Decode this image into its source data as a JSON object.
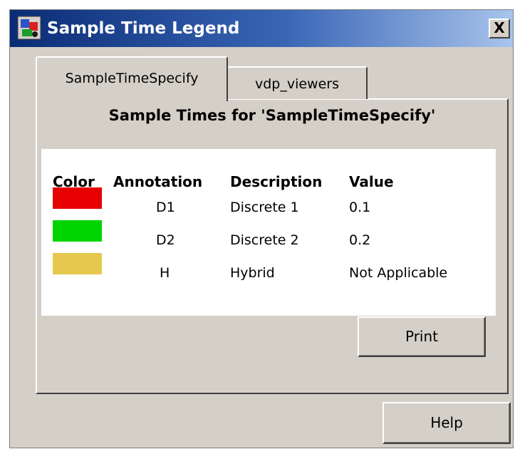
{
  "window": {
    "title": "Sample Time Legend",
    "close_label": "X"
  },
  "tabs": [
    {
      "label": "SampleTimeSpecify",
      "active": true
    },
    {
      "label": "vdp_viewers",
      "active": false
    }
  ],
  "panel": {
    "heading": "Sample Times for 'SampleTimeSpecify'"
  },
  "legend": {
    "columns": [
      "Color",
      "Annotation",
      "Description",
      "Value"
    ],
    "rows": [
      {
        "color": "#e60000",
        "annotation": "D1",
        "description": "Discrete 1",
        "value": "0.1"
      },
      {
        "color": "#00d400",
        "annotation": "D2",
        "description": "Discrete 2",
        "value": "0.2"
      },
      {
        "color": "#e6c84f",
        "annotation": "H",
        "description": "Hybrid",
        "value": "Not Applicable"
      }
    ]
  },
  "buttons": {
    "print": "Print",
    "help": "Help"
  },
  "icons": {
    "app": "simulink-model-icon",
    "close": "close-icon"
  }
}
